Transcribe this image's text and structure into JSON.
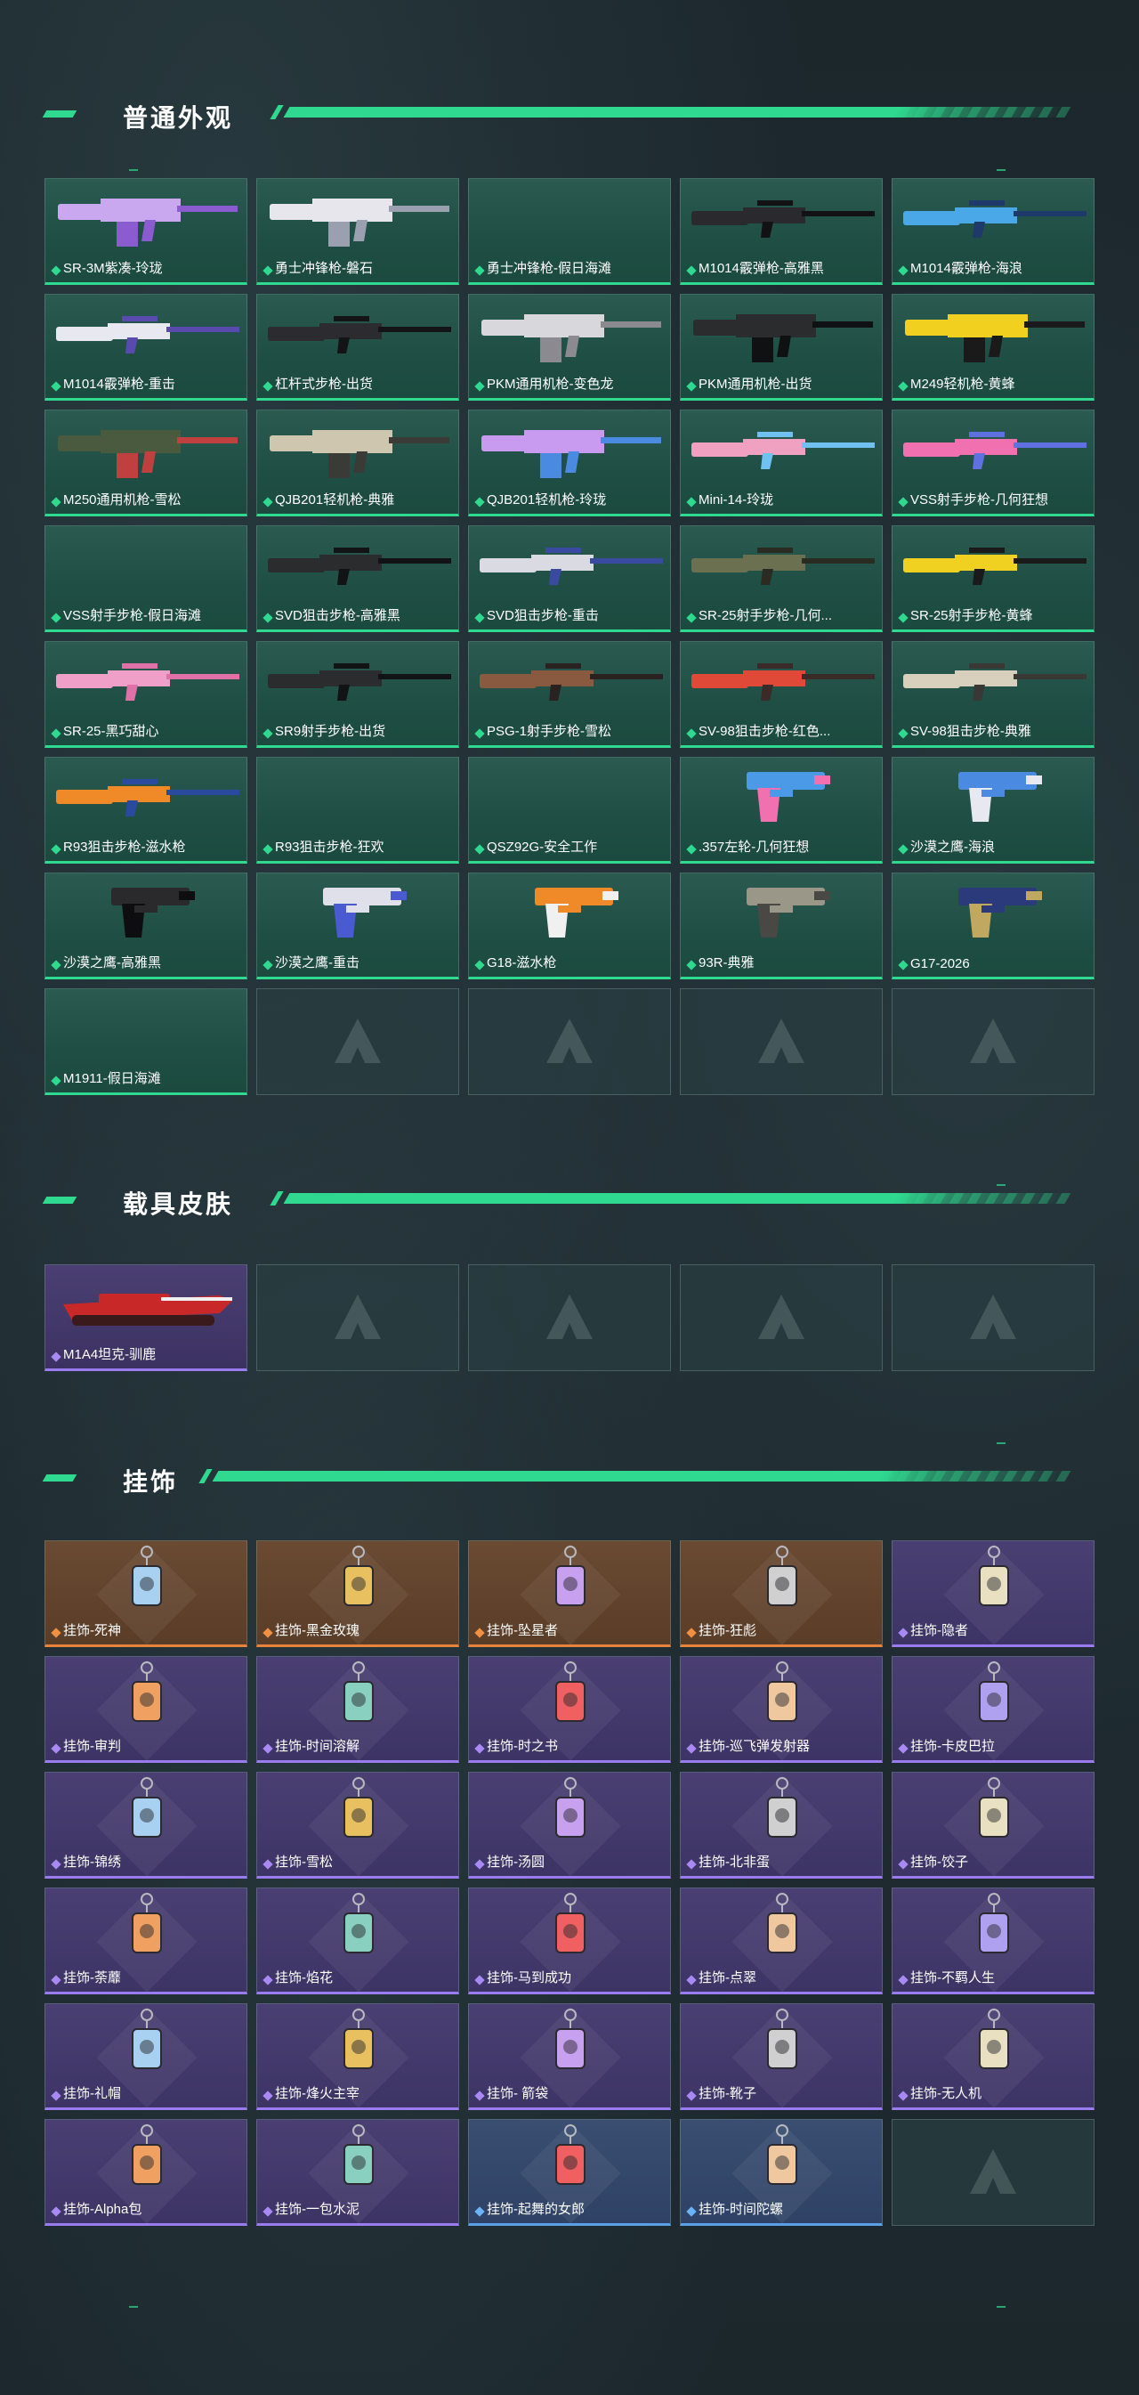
{
  "sections": {
    "skins": {
      "title": "普通外观"
    },
    "vehicles": {
      "title": "载具皮肤"
    },
    "charms": {
      "title": "挂饰"
    }
  },
  "skins": [
    {
      "label": "SR-3M紫凑-玲珑",
      "art": "gun-purple"
    },
    {
      "label": "勇士冲锋枪-磐石",
      "art": "gun-white"
    },
    {
      "label": "勇士冲锋枪-假日海滩",
      "art": "none"
    },
    {
      "label": "M1014霰弹枪-高雅黑",
      "art": "shotgun-black"
    },
    {
      "label": "M1014霰弹枪-海浪",
      "art": "shotgun-blue"
    },
    {
      "label": "M1014霰弹枪-重击",
      "art": "shotgun-white"
    },
    {
      "label": "杠杆式步枪-出货",
      "art": "rifle-black"
    },
    {
      "label": "PKM通用机枪-变色龙",
      "art": "lmg-white"
    },
    {
      "label": "PKM通用机枪-出货",
      "art": "lmg-black"
    },
    {
      "label": "M249轻机枪-黄蜂",
      "art": "lmg-yellow"
    },
    {
      "label": "M250通用机枪-雪松",
      "art": "lmg-green"
    },
    {
      "label": "QJB201轻机枪-典雅",
      "art": "lmg-beige"
    },
    {
      "label": "QJB201轻机枪-玲珑",
      "art": "lmg-purple"
    },
    {
      "label": "Mini-14-玲珑",
      "art": "rifle-rainbow"
    },
    {
      "label": "VSS射手步枪-几何狂想",
      "art": "rifle-pink"
    },
    {
      "label": "VSS射手步枪-假日海滩",
      "art": "none"
    },
    {
      "label": "SVD狙击步枪-高雅黑",
      "art": "sniper-black"
    },
    {
      "label": "SVD狙击步枪-重击",
      "art": "sniper-white"
    },
    {
      "label": "SR-25射手步枪-几何...",
      "art": "sniper-camo"
    },
    {
      "label": "SR-25射手步枪-黄蜂",
      "art": "sniper-yellow"
    },
    {
      "label": "SR-25-黑巧甜心",
      "art": "rifle-pinkcamo"
    },
    {
      "label": "SR9射手步枪-出货",
      "art": "sniper-black"
    },
    {
      "label": "PSG-1射手步枪-雪松",
      "art": "sniper-brown"
    },
    {
      "label": "SV-98狙击步枪-红色...",
      "art": "sniper-red"
    },
    {
      "label": "SV-98狙击步枪-典雅",
      "art": "sniper-beige"
    },
    {
      "label": "R93狙击步枪-滋水枪",
      "art": "sniper-orange"
    },
    {
      "label": "R93狙击步枪-狂欢",
      "art": "none"
    },
    {
      "label": "QSZ92G-安全工作",
      "art": "none"
    },
    {
      "label": ".357左轮-几何狂想",
      "art": "pistol-pink"
    },
    {
      "label": "沙漠之鹰-海浪",
      "art": "pistol-blue"
    },
    {
      "label": "沙漠之鹰-高雅黑",
      "art": "pistol-black"
    },
    {
      "label": "沙漠之鹰-重击",
      "art": "pistol-white"
    },
    {
      "label": "G18-滋水枪",
      "art": "pistol-orange"
    },
    {
      "label": "93R-典雅",
      "art": "pistol-beige"
    },
    {
      "label": "G17-2026",
      "art": "pistol-navy"
    },
    {
      "label": "M1911-假日海滩",
      "art": "none"
    }
  ],
  "vehicles": [
    {
      "label": "M1A4坦克-驯鹿",
      "art": "tank-red"
    }
  ],
  "charms": [
    {
      "label": "挂饰-死神",
      "rarity": "orange"
    },
    {
      "label": "挂饰-黑金玫瑰",
      "rarity": "orange"
    },
    {
      "label": "挂饰-坠星者",
      "rarity": "orange"
    },
    {
      "label": "挂饰-狂彪",
      "rarity": "orange"
    },
    {
      "label": "挂饰-隐者",
      "rarity": "purple"
    },
    {
      "label": "挂饰-审判",
      "rarity": "purple"
    },
    {
      "label": "挂饰-时间溶解",
      "rarity": "purple"
    },
    {
      "label": "挂饰-时之书",
      "rarity": "purple"
    },
    {
      "label": "挂饰-巡飞弹发射器",
      "rarity": "purple"
    },
    {
      "label": "挂饰-卡皮巴拉",
      "rarity": "purple"
    },
    {
      "label": "挂饰-锦绣",
      "rarity": "purple"
    },
    {
      "label": "挂饰-雪松",
      "rarity": "purple"
    },
    {
      "label": "挂饰-汤圆",
      "rarity": "purple"
    },
    {
      "label": "挂饰-北非蛋",
      "rarity": "purple"
    },
    {
      "label": "挂饰-饺子",
      "rarity": "purple"
    },
    {
      "label": "挂饰-荼蘼",
      "rarity": "purple"
    },
    {
      "label": "挂饰-焰花",
      "rarity": "purple"
    },
    {
      "label": "挂饰-马到成功",
      "rarity": "purple"
    },
    {
      "label": "挂饰-点翠",
      "rarity": "purple"
    },
    {
      "label": "挂饰-不羁人生",
      "rarity": "purple"
    },
    {
      "label": "挂饰-礼帽",
      "rarity": "purple"
    },
    {
      "label": "挂饰-烽火主宰",
      "rarity": "purple"
    },
    {
      "label": "挂饰- 箭袋",
      "rarity": "purple"
    },
    {
      "label": "挂饰-靴子",
      "rarity": "purple"
    },
    {
      "label": "挂饰-无人机",
      "rarity": "purple"
    },
    {
      "label": "挂饰-Alpha包",
      "rarity": "purple"
    },
    {
      "label": "挂饰-一包水泥",
      "rarity": "purple"
    },
    {
      "label": "挂饰-起舞的女郎",
      "rarity": "blue"
    },
    {
      "label": "挂饰-时间陀螺",
      "rarity": "blue"
    }
  ],
  "colors": {
    "accent": "#2fd98f",
    "purple": "#9b7cf0",
    "orange": "#e8843a",
    "blue": "#5aa0e8"
  }
}
